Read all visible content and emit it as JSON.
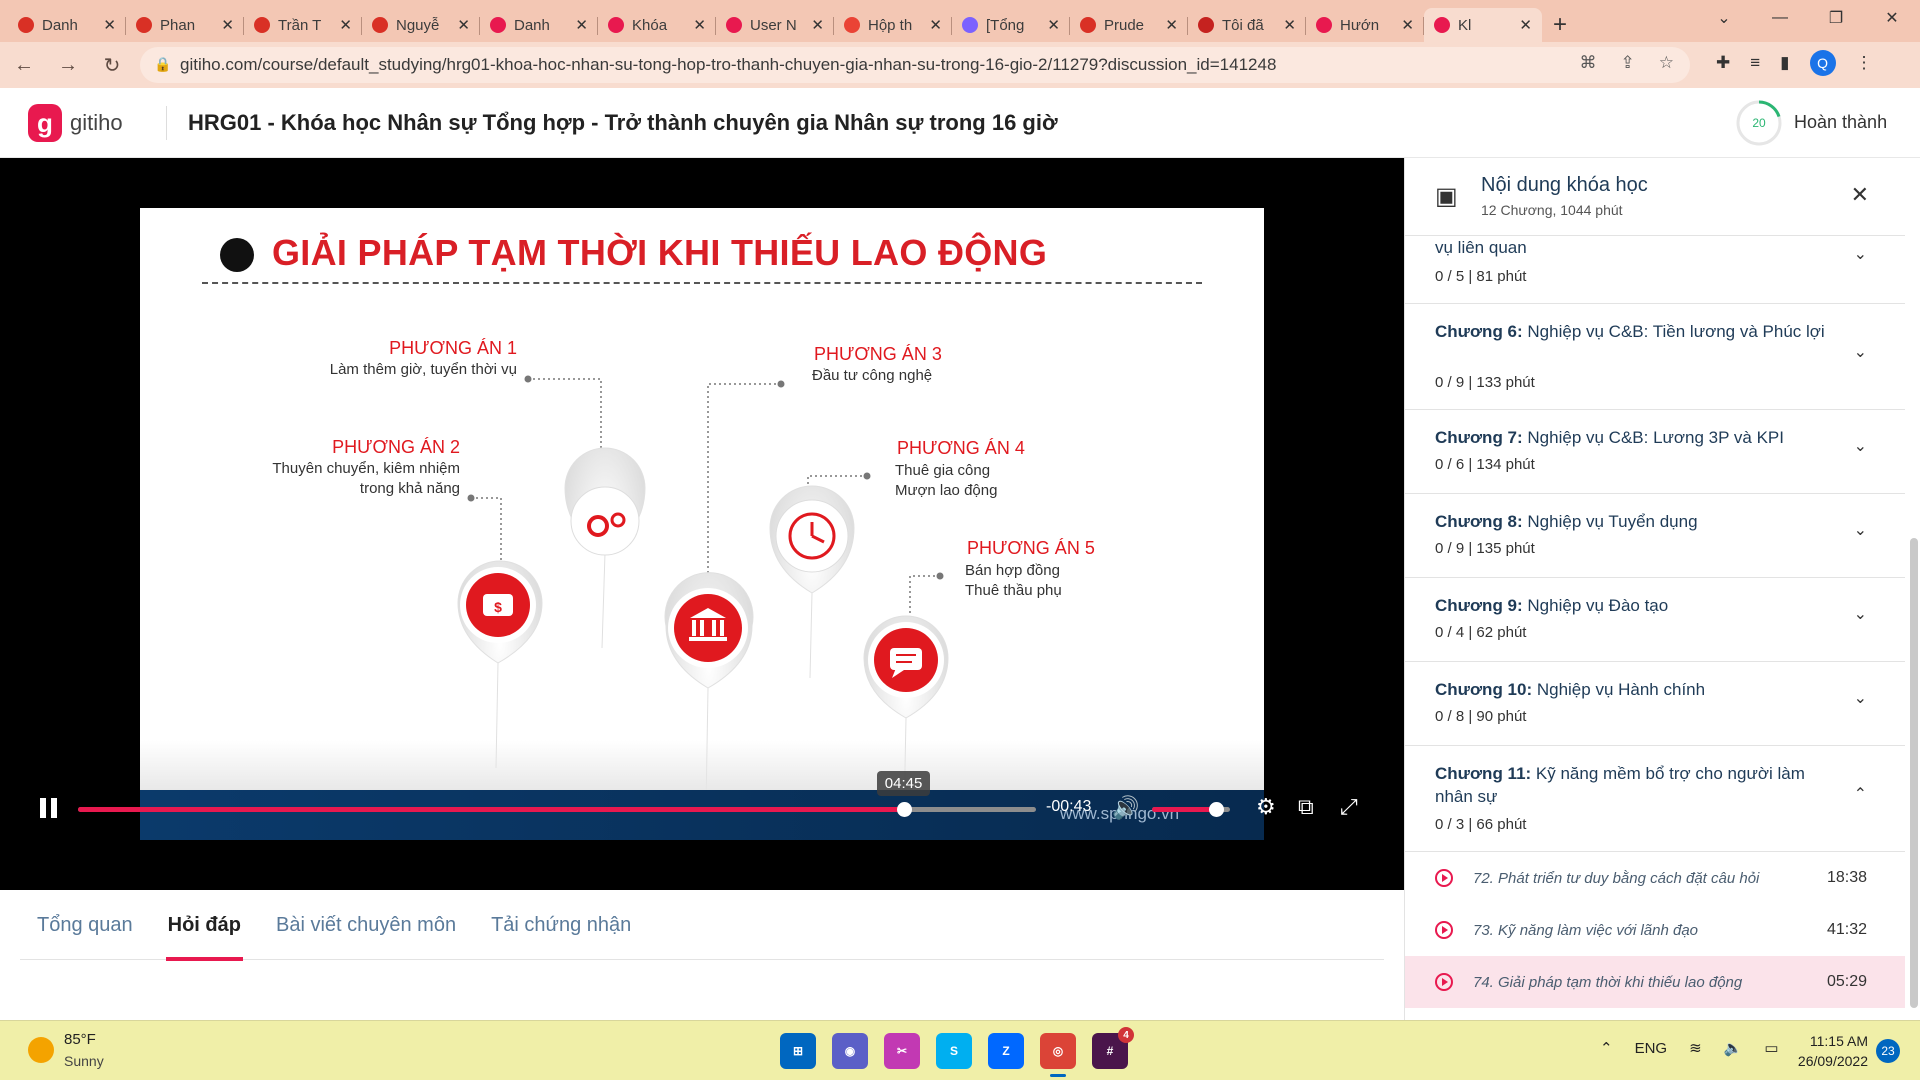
{
  "browser": {
    "tabs": [
      {
        "title": "Danh",
        "color": "#d93025"
      },
      {
        "title": "Phan",
        "color": "#d93025"
      },
      {
        "title": "Trần T",
        "color": "#d93025"
      },
      {
        "title": "Nguyễ",
        "color": "#d93025"
      },
      {
        "title": "Danh",
        "color": "#e8194f"
      },
      {
        "title": "Khóa",
        "color": "#e8194f"
      },
      {
        "title": "User N",
        "color": "#e8194f"
      },
      {
        "title": "Hộp th",
        "color": "#ea4335"
      },
      {
        "title": "[Tổng",
        "color": "#7b61ff"
      },
      {
        "title": "Prude",
        "color": "#d93025"
      },
      {
        "title": "Tôi đã",
        "color": "#c5221f"
      },
      {
        "title": "Hướn",
        "color": "#e8194f"
      },
      {
        "title": "Kl",
        "color": "#e8194f"
      }
    ],
    "url": "gitiho.com/course/default_studying/hrg01-khoa-hoc-nhan-su-tong-hop-tro-thanh-chuyen-gia-nhan-su-trong-16-gio-2/11279?discussion_id=141248",
    "profile_initial": "Q"
  },
  "header": {
    "logo_text": "gitiho",
    "logo_mark": "g",
    "course_title": "HRG01 - Khóa học Nhân sự Tổng hợp - Trở thành chuyên gia Nhân sự trong 16 giờ",
    "progress_value": "20",
    "progress_fraction": 0.2,
    "done_label": "Hoàn thành"
  },
  "slide": {
    "title": "GIẢI PHÁP TẠM THỜI KHI THIẾU LAO ĐỘNG",
    "options": [
      {
        "title": "PHƯƠNG ÁN 1",
        "desc": "Làm thêm giờ, tuyển thời vụ"
      },
      {
        "title": "PHƯƠNG ÁN 2",
        "desc1": "Thuyên chuyển, kiêm nhiệm",
        "desc2": "trong khả năng"
      },
      {
        "title": "PHƯƠNG ÁN 3",
        "desc": "Đầu tư công nghệ"
      },
      {
        "title": "PHƯƠNG ÁN 4",
        "desc1": "Thuê gia công",
        "desc2": "Mượn lao động"
      },
      {
        "title": "PHƯƠNG ÁN 5",
        "desc1": "Bán hợp đồng",
        "desc2": "Thuê thầu phụ"
      }
    ],
    "footer_text": "www.springo.vn"
  },
  "player": {
    "seek_tooltip": "04:45",
    "time_remaining": "-00:43",
    "progress_fraction": 0.862,
    "volume_fraction": 0.82
  },
  "lesson_tabs": [
    {
      "label": "Tổng quan"
    },
    {
      "label": "Hỏi đáp"
    },
    {
      "label": "Bài viết chuyên môn"
    },
    {
      "label": "Tải chứng nhận"
    }
  ],
  "sidebar": {
    "title": "Nội dung khóa học",
    "subtitle": "12 Chương, 1044 phút",
    "chapters": [
      {
        "prefix": "",
        "name": "vụ liên quan",
        "meta": "0 / 5   |   81 phút"
      },
      {
        "prefix": "Chương 6:",
        "name": " Nghiệp vụ C&B: Tiền lương và Phúc lợi",
        "meta": "0 / 9   |   133 phút"
      },
      {
        "prefix": "Chương 7:",
        "name": " Nghiệp vụ C&B: Lương 3P và KPI",
        "meta": "0 / 6   |   134 phút"
      },
      {
        "prefix": "Chương 8:",
        "name": " Nghiệp vụ Tuyển dụng",
        "meta": "0 / 9   |   135 phút"
      },
      {
        "prefix": "Chương 9:",
        "name": " Nghiệp vụ Đào tạo",
        "meta": "0 / 4   |   62 phút"
      },
      {
        "prefix": "Chương 10:",
        "name": " Nghiệp vụ Hành chính",
        "meta": "0 / 8   |   90 phút"
      },
      {
        "prefix": "Chương 11:",
        "name": " Kỹ năng mềm bổ trợ cho người làm nhân sự",
        "meta": "0 / 3   |   66 phút"
      }
    ],
    "lessons": [
      {
        "name": "72. Phát triển tư duy bằng cách đặt câu hỏi",
        "duration": "18:38"
      },
      {
        "name": "73. Kỹ năng làm việc với lãnh đạo",
        "duration": "41:32"
      },
      {
        "name": "74. Giải pháp tạm thời khi thiếu lao động",
        "duration": "05:29"
      }
    ]
  },
  "taskbar": {
    "temp": "85°F",
    "weather": "Sunny",
    "lang": "ENG",
    "time": "11:15 AM",
    "date": "26/09/2022",
    "notifications": "23",
    "slack_badge": "4"
  }
}
